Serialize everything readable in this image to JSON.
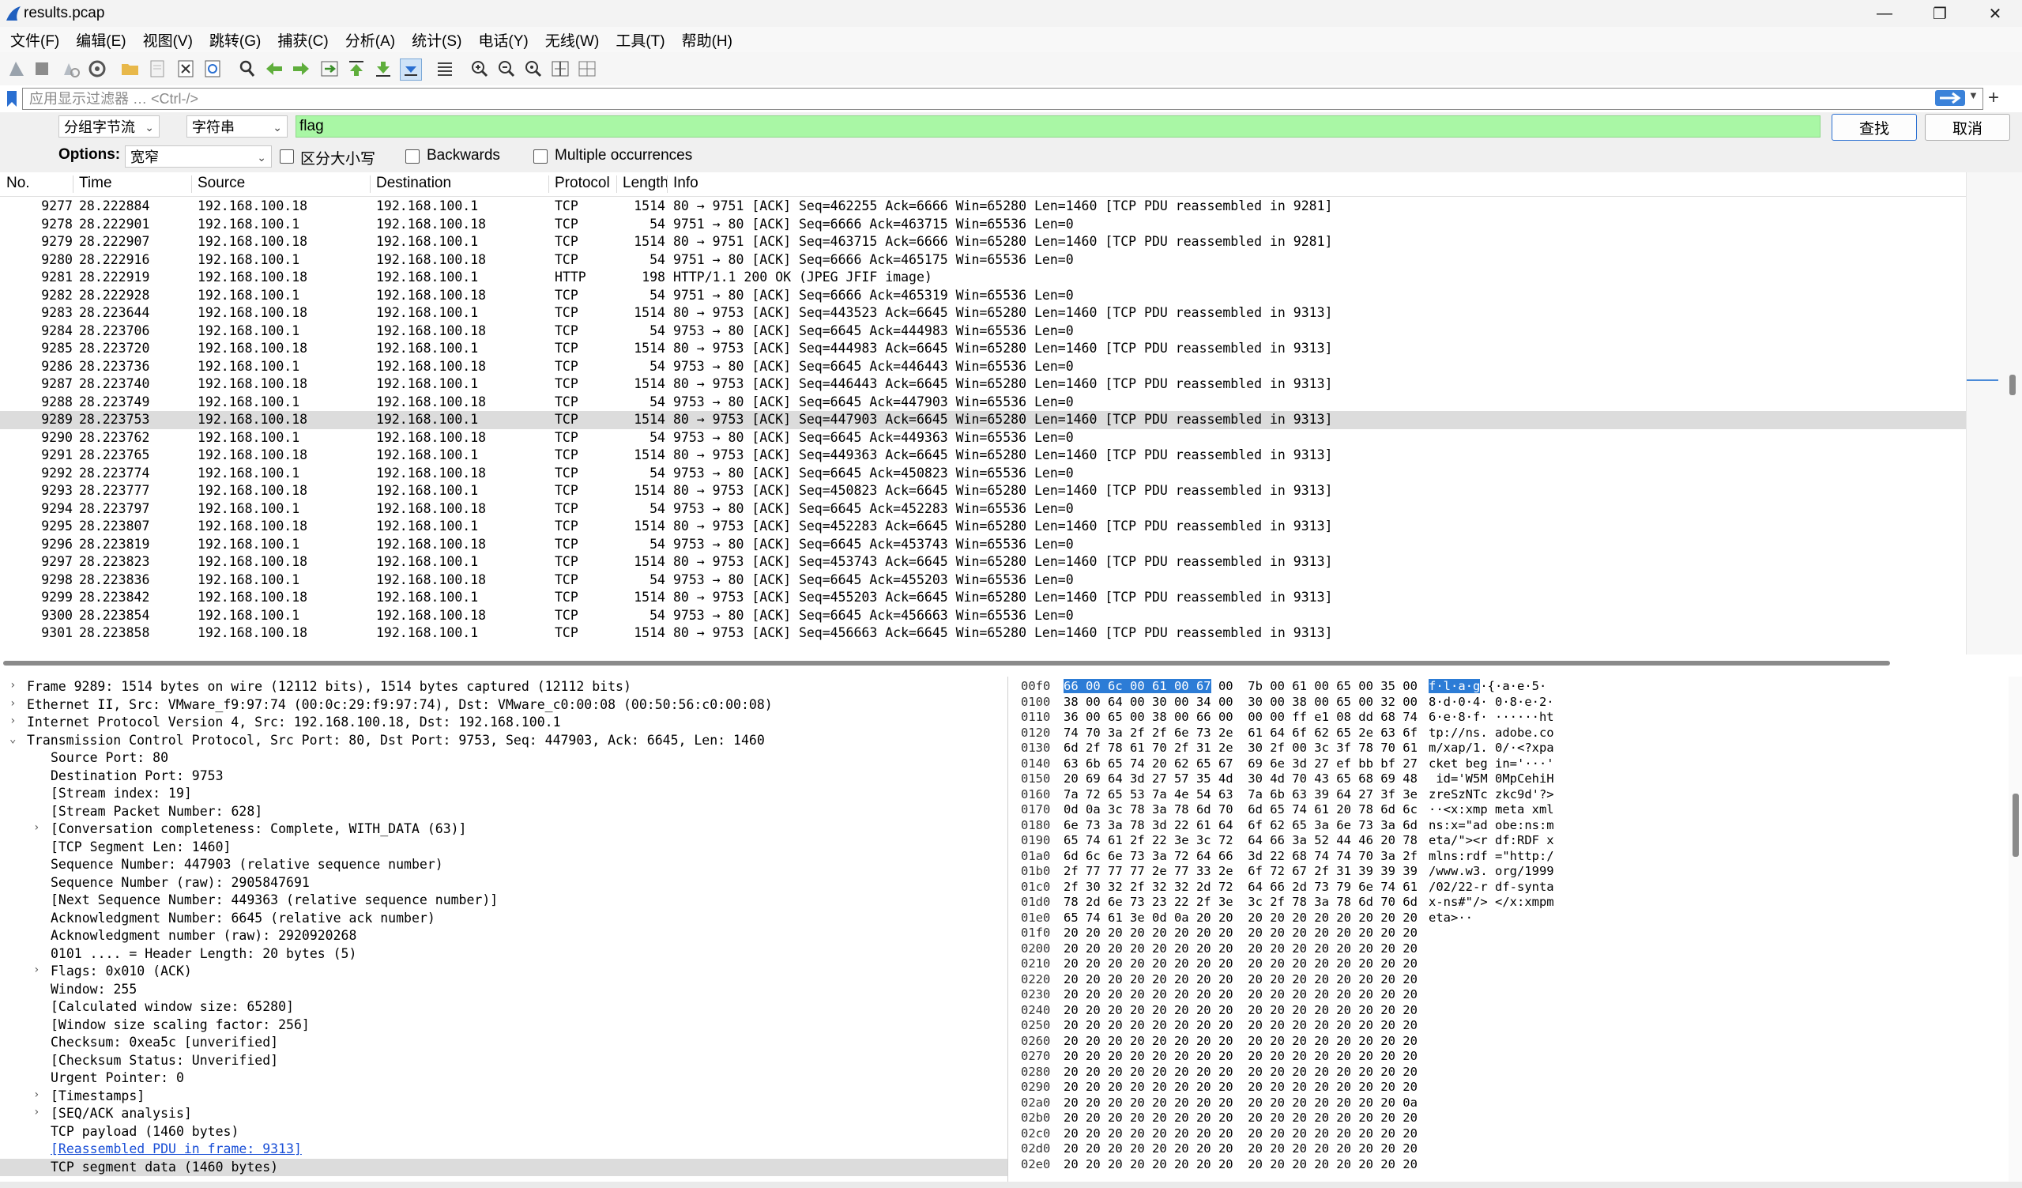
{
  "window": {
    "title": "results.pcap",
    "minimize": "—",
    "maximize": "❐",
    "close": "✕"
  },
  "menu": [
    "文件(F)",
    "编辑(E)",
    "视图(V)",
    "跳转(G)",
    "捕获(C)",
    "分析(A)",
    "统计(S)",
    "电话(Y)",
    "无线(W)",
    "工具(T)",
    "帮助(H)"
  ],
  "filter": {
    "placeholder": "应用显示过滤器 … <Ctrl-/>",
    "add_label": "+"
  },
  "find": {
    "search_in": "分组字节流",
    "search_type": "字符串",
    "search_text": "flag",
    "find_button": "查找",
    "cancel_button": "取消",
    "options_label": "Options:",
    "charset": "宽窄",
    "case_sensitive": "区分大小写",
    "backwards": "Backwards",
    "multiple": "Multiple occurrences"
  },
  "packet_list": {
    "columns": [
      "No.",
      "Time",
      "Source",
      "Destination",
      "Protocol",
      "Length",
      "Info"
    ],
    "selected_index": 12,
    "rows": [
      [
        "9277",
        "28.222884",
        "192.168.100.18",
        "192.168.100.1",
        "TCP",
        "1514",
        "80 → 9751 [ACK] Seq=462255 Ack=6666 Win=65280 Len=1460 [TCP PDU reassembled in 9281]"
      ],
      [
        "9278",
        "28.222901",
        "192.168.100.1",
        "192.168.100.18",
        "TCP",
        "54",
        "9751 → 80 [ACK] Seq=6666 Ack=463715 Win=65536 Len=0"
      ],
      [
        "9279",
        "28.222907",
        "192.168.100.18",
        "192.168.100.1",
        "TCP",
        "1514",
        "80 → 9751 [ACK] Seq=463715 Ack=6666 Win=65280 Len=1460 [TCP PDU reassembled in 9281]"
      ],
      [
        "9280",
        "28.222916",
        "192.168.100.1",
        "192.168.100.18",
        "TCP",
        "54",
        "9751 → 80 [ACK] Seq=6666 Ack=465175 Win=65536 Len=0"
      ],
      [
        "9281",
        "28.222919",
        "192.168.100.18",
        "192.168.100.1",
        "HTTP",
        "198",
        "HTTP/1.1 200 OK  (JPEG JFIF image)"
      ],
      [
        "9282",
        "28.222928",
        "192.168.100.1",
        "192.168.100.18",
        "TCP",
        "54",
        "9751 → 80 [ACK] Seq=6666 Ack=465319 Win=65536 Len=0"
      ],
      [
        "9283",
        "28.223644",
        "192.168.100.18",
        "192.168.100.1",
        "TCP",
        "1514",
        "80 → 9753 [ACK] Seq=443523 Ack=6645 Win=65280 Len=1460 [TCP PDU reassembled in 9313]"
      ],
      [
        "9284",
        "28.223706",
        "192.168.100.1",
        "192.168.100.18",
        "TCP",
        "54",
        "9753 → 80 [ACK] Seq=6645 Ack=444983 Win=65536 Len=0"
      ],
      [
        "9285",
        "28.223720",
        "192.168.100.18",
        "192.168.100.1",
        "TCP",
        "1514",
        "80 → 9753 [ACK] Seq=444983 Ack=6645 Win=65280 Len=1460 [TCP PDU reassembled in 9313]"
      ],
      [
        "9286",
        "28.223736",
        "192.168.100.1",
        "192.168.100.18",
        "TCP",
        "54",
        "9753 → 80 [ACK] Seq=6645 Ack=446443 Win=65536 Len=0"
      ],
      [
        "9287",
        "28.223740",
        "192.168.100.18",
        "192.168.100.1",
        "TCP",
        "1514",
        "80 → 9753 [ACK] Seq=446443 Ack=6645 Win=65280 Len=1460 [TCP PDU reassembled in 9313]"
      ],
      [
        "9288",
        "28.223749",
        "192.168.100.1",
        "192.168.100.18",
        "TCP",
        "54",
        "9753 → 80 [ACK] Seq=6645 Ack=447903 Win=65536 Len=0"
      ],
      [
        "9289",
        "28.223753",
        "192.168.100.18",
        "192.168.100.1",
        "TCP",
        "1514",
        "80 → 9753 [ACK] Seq=447903 Ack=6645 Win=65280 Len=1460 [TCP PDU reassembled in 9313]"
      ],
      [
        "9290",
        "28.223762",
        "192.168.100.1",
        "192.168.100.18",
        "TCP",
        "54",
        "9753 → 80 [ACK] Seq=6645 Ack=449363 Win=65536 Len=0"
      ],
      [
        "9291",
        "28.223765",
        "192.168.100.18",
        "192.168.100.1",
        "TCP",
        "1514",
        "80 → 9753 [ACK] Seq=449363 Ack=6645 Win=65280 Len=1460 [TCP PDU reassembled in 9313]"
      ],
      [
        "9292",
        "28.223774",
        "192.168.100.1",
        "192.168.100.18",
        "TCP",
        "54",
        "9753 → 80 [ACK] Seq=6645 Ack=450823 Win=65536 Len=0"
      ],
      [
        "9293",
        "28.223777",
        "192.168.100.18",
        "192.168.100.1",
        "TCP",
        "1514",
        "80 → 9753 [ACK] Seq=450823 Ack=6645 Win=65280 Len=1460 [TCP PDU reassembled in 9313]"
      ],
      [
        "9294",
        "28.223797",
        "192.168.100.1",
        "192.168.100.18",
        "TCP",
        "54",
        "9753 → 80 [ACK] Seq=6645 Ack=452283 Win=65536 Len=0"
      ],
      [
        "9295",
        "28.223807",
        "192.168.100.18",
        "192.168.100.1",
        "TCP",
        "1514",
        "80 → 9753 [ACK] Seq=452283 Ack=6645 Win=65280 Len=1460 [TCP PDU reassembled in 9313]"
      ],
      [
        "9296",
        "28.223819",
        "192.168.100.1",
        "192.168.100.18",
        "TCP",
        "54",
        "9753 → 80 [ACK] Seq=6645 Ack=453743 Win=65536 Len=0"
      ],
      [
        "9297",
        "28.223823",
        "192.168.100.18",
        "192.168.100.1",
        "TCP",
        "1514",
        "80 → 9753 [ACK] Seq=453743 Ack=6645 Win=65280 Len=1460 [TCP PDU reassembled in 9313]"
      ],
      [
        "9298",
        "28.223836",
        "192.168.100.1",
        "192.168.100.18",
        "TCP",
        "54",
        "9753 → 80 [ACK] Seq=6645 Ack=455203 Win=65536 Len=0"
      ],
      [
        "9299",
        "28.223842",
        "192.168.100.18",
        "192.168.100.1",
        "TCP",
        "1514",
        "80 → 9753 [ACK] Seq=455203 Ack=6645 Win=65280 Len=1460 [TCP PDU reassembled in 9313]"
      ],
      [
        "9300",
        "28.223854",
        "192.168.100.1",
        "192.168.100.18",
        "TCP",
        "54",
        "9753 → 80 [ACK] Seq=6645 Ack=456663 Win=65536 Len=0"
      ],
      [
        "9301",
        "28.223858",
        "192.168.100.18",
        "192.168.100.1",
        "TCP",
        "1514",
        "80 → 9753 [ACK] Seq=456663 Ack=6645 Win=65280 Len=1460 [TCP PDU reassembled in 9313]"
      ]
    ]
  },
  "details": [
    {
      "text": "Frame 9289: 1514 bytes on wire (12112 bits), 1514 bytes captured (12112 bits)",
      "indent": 0,
      "exp": "›"
    },
    {
      "text": "Ethernet II, Src: VMware_f9:97:74 (00:0c:29:f9:97:74), Dst: VMware_c0:00:08 (00:50:56:c0:00:08)",
      "indent": 0,
      "exp": "›"
    },
    {
      "text": "Internet Protocol Version 4, Src: 192.168.100.18, Dst: 192.168.100.1",
      "indent": 0,
      "exp": "›"
    },
    {
      "text": "Transmission Control Protocol, Src Port: 80, Dst Port: 9753, Seq: 447903, Ack: 6645, Len: 1460",
      "indent": 0,
      "exp": "⌄"
    },
    {
      "text": "Source Port: 80",
      "indent": 1,
      "exp": ""
    },
    {
      "text": "Destination Port: 9753",
      "indent": 1,
      "exp": ""
    },
    {
      "text": "[Stream index: 19]",
      "indent": 1,
      "exp": ""
    },
    {
      "text": "[Stream Packet Number: 628]",
      "indent": 1,
      "exp": ""
    },
    {
      "text": "[Conversation completeness: Complete, WITH_DATA (63)]",
      "indent": 1,
      "exp": "›"
    },
    {
      "text": "[TCP Segment Len: 1460]",
      "indent": 1,
      "exp": ""
    },
    {
      "text": "Sequence Number: 447903    (relative sequence number)",
      "indent": 1,
      "exp": ""
    },
    {
      "text": "Sequence Number (raw): 2905847691",
      "indent": 1,
      "exp": ""
    },
    {
      "text": "[Next Sequence Number: 449363    (relative sequence number)]",
      "indent": 1,
      "exp": ""
    },
    {
      "text": "Acknowledgment Number: 6645    (relative ack number)",
      "indent": 1,
      "exp": ""
    },
    {
      "text": "Acknowledgment number (raw): 2920920268",
      "indent": 1,
      "exp": ""
    },
    {
      "text": "0101 .... = Header Length: 20 bytes (5)",
      "indent": 1,
      "exp": ""
    },
    {
      "text": "Flags: 0x010 (ACK)",
      "indent": 1,
      "exp": "›"
    },
    {
      "text": "Window: 255",
      "indent": 1,
      "exp": ""
    },
    {
      "text": "[Calculated window size: 65280]",
      "indent": 1,
      "exp": ""
    },
    {
      "text": "[Window size scaling factor: 256]",
      "indent": 1,
      "exp": ""
    },
    {
      "text": "Checksum: 0xea5c [unverified]",
      "indent": 1,
      "exp": ""
    },
    {
      "text": "[Checksum Status: Unverified]",
      "indent": 1,
      "exp": ""
    },
    {
      "text": "Urgent Pointer: 0",
      "indent": 1,
      "exp": ""
    },
    {
      "text": "[Timestamps]",
      "indent": 1,
      "exp": "›"
    },
    {
      "text": "[SEQ/ACK analysis]",
      "indent": 1,
      "exp": "›"
    },
    {
      "text": "TCP payload (1460 bytes)",
      "indent": 1,
      "exp": ""
    },
    {
      "text": "[Reassembled PDU in frame: 9313]",
      "indent": 1,
      "exp": "",
      "link": true
    },
    {
      "text": "TCP segment data (1460 bytes)",
      "indent": 1,
      "exp": "",
      "selected": true
    }
  ],
  "bytes": {
    "first_row_highlight_hex": "66 00 6c 00 61 00 67",
    "first_row_highlight_ascii": "f·l·a·g",
    "rows": [
      {
        "off": "00f0",
        "hex": " 00  7b 00 61 00 65 00 35 00",
        "asc": "·{·a·e·5·"
      },
      {
        "off": "0100",
        "hex": "38 00 64 00 30 00 34 00  30 00 38 00 65 00 32 00",
        "asc": "8·d·0·4· 0·8·e·2·"
      },
      {
        "off": "0110",
        "hex": "36 00 65 00 38 00 66 00  00 00 ff e1 08 dd 68 74",
        "asc": "6·e·8·f· ······ht"
      },
      {
        "off": "0120",
        "hex": "74 70 3a 2f 2f 6e 73 2e  61 64 6f 62 65 2e 63 6f",
        "asc": "tp://ns. adobe.co"
      },
      {
        "off": "0130",
        "hex": "6d 2f 78 61 70 2f 31 2e  30 2f 00 3c 3f 78 70 61",
        "asc": "m/xap/1. 0/·<?xpa"
      },
      {
        "off": "0140",
        "hex": "63 6b 65 74 20 62 65 67  69 6e 3d 27 ef bb bf 27",
        "asc": "cket beg in='···'"
      },
      {
        "off": "0150",
        "hex": "20 69 64 3d 27 57 35 4d  30 4d 70 43 65 68 69 48",
        "asc": " id='W5M 0MpCehiH"
      },
      {
        "off": "0160",
        "hex": "7a 72 65 53 7a 4e 54 63  7a 6b 63 39 64 27 3f 3e",
        "asc": "zreSzNTc zkc9d'?>"
      },
      {
        "off": "0170",
        "hex": "0d 0a 3c 78 3a 78 6d 70  6d 65 74 61 20 78 6d 6c",
        "asc": "··<x:xmp meta xml"
      },
      {
        "off": "0180",
        "hex": "6e 73 3a 78 3d 22 61 64  6f 62 65 3a 6e 73 3a 6d",
        "asc": "ns:x=\"ad obe:ns:m"
      },
      {
        "off": "0190",
        "hex": "65 74 61 2f 22 3e 3c 72  64 66 3a 52 44 46 20 78",
        "asc": "eta/\"><r df:RDF x"
      },
      {
        "off": "01a0",
        "hex": "6d 6c 6e 73 3a 72 64 66  3d 22 68 74 74 70 3a 2f",
        "asc": "mlns:rdf =\"http:/"
      },
      {
        "off": "01b0",
        "hex": "2f 77 77 77 2e 77 33 2e  6f 72 67 2f 31 39 39 39",
        "asc": "/www.w3. org/1999"
      },
      {
        "off": "01c0",
        "hex": "2f 30 32 2f 32 32 2d 72  64 66 2d 73 79 6e 74 61",
        "asc": "/02/22-r df-synta"
      },
      {
        "off": "01d0",
        "hex": "78 2d 6e 73 23 22 2f 3e  3c 2f 78 3a 78 6d 70 6d",
        "asc": "x-ns#\"/> </x:xmpm"
      },
      {
        "off": "01e0",
        "hex": "65 74 61 3e 0d 0a 20 20  20 20 20 20 20 20 20 20",
        "asc": "eta>··"
      },
      {
        "off": "01f0",
        "hex": "20 20 20 20 20 20 20 20  20 20 20 20 20 20 20 20",
        "asc": ""
      },
      {
        "off": "0200",
        "hex": "20 20 20 20 20 20 20 20  20 20 20 20 20 20 20 20",
        "asc": ""
      },
      {
        "off": "0210",
        "hex": "20 20 20 20 20 20 20 20  20 20 20 20 20 20 20 20",
        "asc": ""
      },
      {
        "off": "0220",
        "hex": "20 20 20 20 20 20 20 20  20 20 20 20 20 20 20 20",
        "asc": ""
      },
      {
        "off": "0230",
        "hex": "20 20 20 20 20 20 20 20  20 20 20 20 20 20 20 20",
        "asc": ""
      },
      {
        "off": "0240",
        "hex": "20 20 20 20 20 20 20 20  20 20 20 20 20 20 20 20",
        "asc": ""
      },
      {
        "off": "0250",
        "hex": "20 20 20 20 20 20 20 20  20 20 20 20 20 20 20 20",
        "asc": ""
      },
      {
        "off": "0260",
        "hex": "20 20 20 20 20 20 20 20  20 20 20 20 20 20 20 20",
        "asc": ""
      },
      {
        "off": "0270",
        "hex": "20 20 20 20 20 20 20 20  20 20 20 20 20 20 20 20",
        "asc": ""
      },
      {
        "off": "0280",
        "hex": "20 20 20 20 20 20 20 20  20 20 20 20 20 20 20 20",
        "asc": ""
      },
      {
        "off": "0290",
        "hex": "20 20 20 20 20 20 20 20  20 20 20 20 20 20 20 20",
        "asc": ""
      },
      {
        "off": "02a0",
        "hex": "20 20 20 20 20 20 20 20  20 20 20 20 20 20 20 0a",
        "asc": ""
      },
      {
        "off": "02b0",
        "hex": "20 20 20 20 20 20 20 20  20 20 20 20 20 20 20 20",
        "asc": ""
      },
      {
        "off": "02c0",
        "hex": "20 20 20 20 20 20 20 20  20 20 20 20 20 20 20 20",
        "asc": ""
      },
      {
        "off": "02d0",
        "hex": "20 20 20 20 20 20 20 20  20 20 20 20 20 20 20 20",
        "asc": ""
      },
      {
        "off": "02e0",
        "hex": "20 20 20 20 20 20 20 20  20 20 20 20 20 20 20 20",
        "asc": ""
      }
    ]
  },
  "colors": {
    "find_highlight": "#a9f7a5",
    "byte_highlight": "#2c7cd6",
    "selected_row": "#dcdcdc",
    "link": "#1a4fd6"
  }
}
